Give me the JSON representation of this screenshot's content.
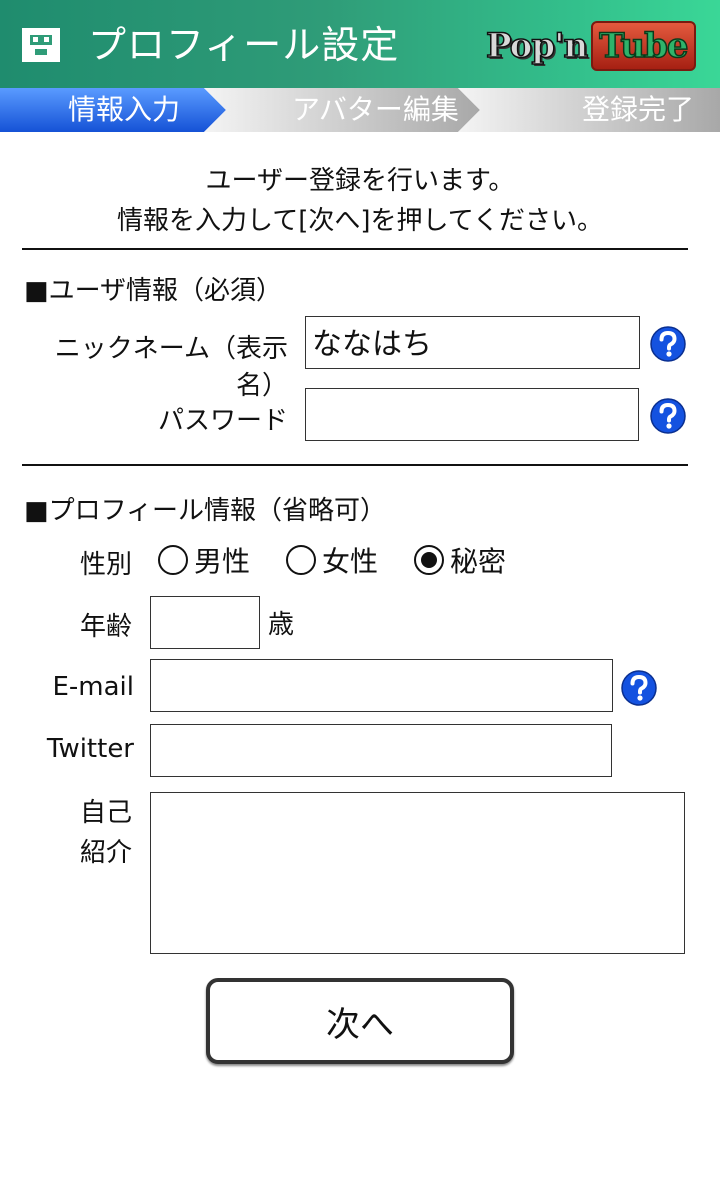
{
  "header": {
    "title": "プロフィール設定",
    "brand_pop": "Pop'n",
    "brand_tube": "Tube",
    "colors": {
      "header_green": "#2f9c78",
      "active_step_blue": "#1b64e6"
    }
  },
  "steps": [
    {
      "label": "情報入力",
      "active": true
    },
    {
      "label": "アバター編集",
      "active": false
    },
    {
      "label": "登録完了",
      "active": false
    }
  ],
  "intro": {
    "line1": "ユーザー登録を行います。",
    "line2": "情報を入力して[次へ]を押してください。"
  },
  "user_section": {
    "title": "■ユーザ情報（必須）",
    "nickname_label": "ニックネーム（表示名）",
    "nickname_value": "ななはち",
    "password_label": "パスワード",
    "password_value": ""
  },
  "profile_section": {
    "title": "■プロフィール情報（省略可）",
    "gender_label": "性別",
    "gender_options": [
      "男性",
      "女性",
      "秘密"
    ],
    "gender_selected": "秘密",
    "age_label": "年齢",
    "age_value": "",
    "age_unit": "歳",
    "email_label": "E-mail",
    "email_value": "",
    "twitter_label": "Twitter",
    "twitter_value": "",
    "bio_label_line1": "自己",
    "bio_label_line2": "紹介",
    "bio_value": ""
  },
  "actions": {
    "next_label": "次へ"
  },
  "icons": {
    "help": "question-circle-icon",
    "app": "profile-card-icon"
  }
}
